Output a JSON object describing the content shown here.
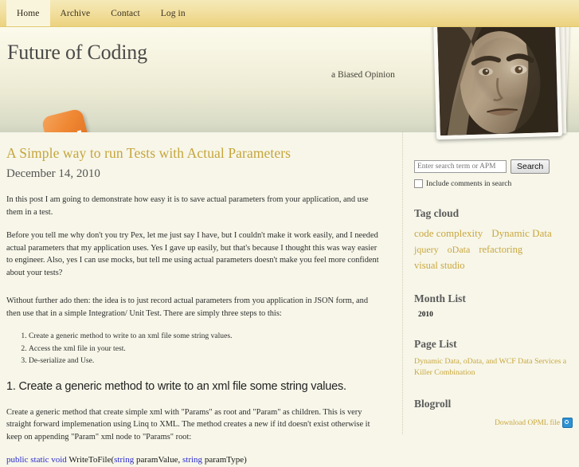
{
  "nav": {
    "items": [
      {
        "label": "Home",
        "active": true
      },
      {
        "label": "Archive",
        "active": false
      },
      {
        "label": "Contact",
        "active": false
      },
      {
        "label": "Log in",
        "active": false
      }
    ]
  },
  "header": {
    "site_title": "Future of Coding",
    "tagline": "a Biased Opinion",
    "rss_icon": "rss-icon",
    "photo_alt": "portrait-photo"
  },
  "post": {
    "title": "A Simple way to run Tests with Actual Parameters",
    "date": "December 14, 2010",
    "paragraphs": [
      "In this post I am going to demonstrate how easy it is to save actual parameters from your application, and use them in a test.",
      "Before you tell me why don't you try Pex, let me just say I have, but I couldn't make it work easily, and I needed actual parameters that my application uses.  Yes I gave up easily, but that's because I thought this was way easier to engineer. Also, yes I can use mocks, but tell me  using actual parameters  doesn't make you feel more confident about your tests?",
      "Without further ado then: the idea is to just record actual parameters from you application in JSON form,  and then use that in a simple Integration/ Unit Test. There are simply three steps to this:"
    ],
    "steps": [
      "Create a generic method to write to an xml file some string values.",
      "Access the xml file in your test.",
      "De-serialize and Use."
    ],
    "section_heading": "1. Create a generic method to write to an xml file some string values.",
    "section_paragraph": "Create a generic method that create simple xml with \"Params\" as root and \"Param\" as children. This is very straight forward implemenation using Linq to XML. The method creates a new if itd doesn't exist otherwise it keep on appending \"Param\" xml node to \"Params\" root:",
    "code": {
      "k1": "public static void ",
      "t1": "WriteToFile(",
      "k2": "string",
      "t2": " paramValue, ",
      "k3": "string",
      "t3": " paramType)"
    }
  },
  "sidebar": {
    "search": {
      "placeholder": "Enter search term or APM",
      "value": "",
      "button_label": "Search",
      "checkbox_label": "Include comments in search",
      "checkbox_checked": false
    },
    "tag_cloud": {
      "heading": "Tag cloud",
      "tags": [
        {
          "label": "code complexity",
          "size": 13
        },
        {
          "label": "Dynamic Data",
          "size": 13
        },
        {
          "label": "jquery",
          "size": 12
        },
        {
          "label": "oData",
          "size": 12
        },
        {
          "label": "refactoring",
          "size": 12.5
        },
        {
          "label": "visual studio",
          "size": 12.5
        }
      ]
    },
    "month_list": {
      "heading": "Month List",
      "items": [
        "2010"
      ]
    },
    "page_list": {
      "heading": "Page List",
      "items": [
        "Dynamic Data, oData, and WCF Data Services a Killer Combination"
      ]
    },
    "blogroll": {
      "heading": "Blogroll",
      "opml_label": "Download OPML file",
      "opml_icon": "opml-icon"
    }
  },
  "colors": {
    "accent_gold": "#c9a73e",
    "nav_gradient_top": "#f4e9b8",
    "nav_gradient_bottom": "#ecd27f",
    "page_bg": "#f7f6e9",
    "code_keyword": "#2a2ad0",
    "rss_orange": "#ef8733"
  }
}
